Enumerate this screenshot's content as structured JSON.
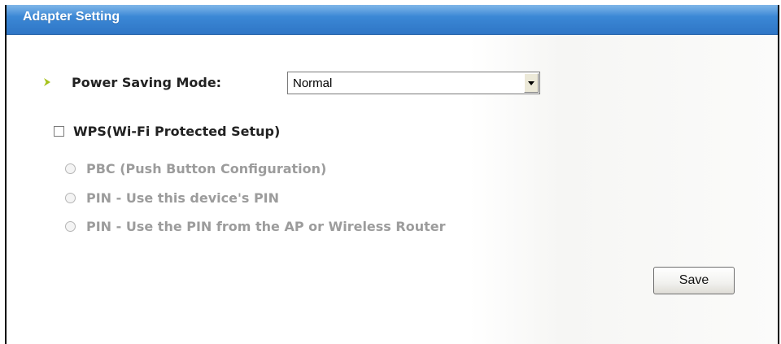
{
  "header": {
    "title": "Adapter Setting"
  },
  "power_saving": {
    "label": "Power Saving Mode:",
    "selected": "Normal"
  },
  "wps": {
    "label": "WPS(Wi-Fi Protected Setup)",
    "checked": false,
    "options": [
      {
        "label": "PBC (Push Button Configuration)",
        "enabled": false
      },
      {
        "label": "PIN - Use this device's PIN",
        "enabled": false
      },
      {
        "label": "PIN - Use the PIN from the AP or Wireless Router",
        "enabled": false
      }
    ]
  },
  "actions": {
    "save_label": "Save"
  },
  "icons": {
    "bullet": "arrow-bullet-icon",
    "dropdown": "chevron-down-icon"
  },
  "colors": {
    "header": "#3a86d4",
    "bullet": "#a6c21a",
    "disabled_text": "#9c9c9c"
  }
}
